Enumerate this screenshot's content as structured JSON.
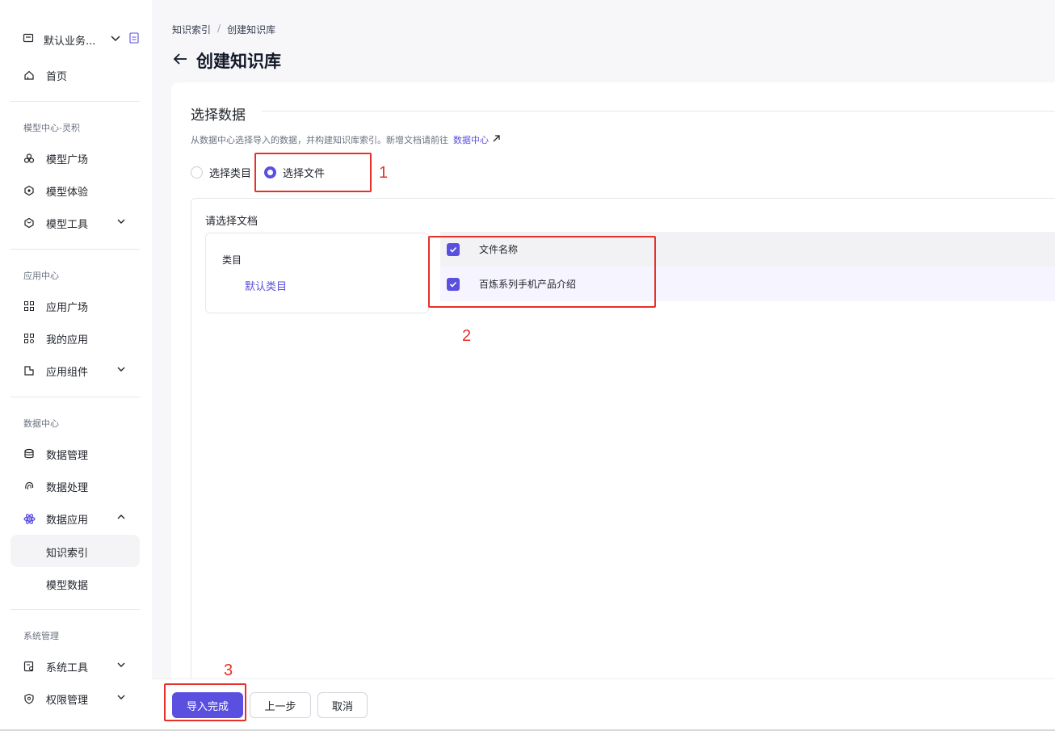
{
  "workspace": {
    "name": "默认业务..."
  },
  "nav": {
    "home": "首页",
    "groups": [
      {
        "title": "模型中心-灵积",
        "items": [
          "模型广场",
          "模型体验",
          "模型工具"
        ]
      },
      {
        "title": "应用中心",
        "items": [
          "应用广场",
          "我的应用",
          "应用组件"
        ]
      },
      {
        "title": "数据中心",
        "items": [
          "数据管理",
          "数据处理",
          "数据应用"
        ]
      },
      {
        "title": "系统管理",
        "items": [
          "系统工具",
          "权限管理"
        ]
      }
    ],
    "data_app_sub": [
      "知识索引",
      "模型数据"
    ]
  },
  "breadcrumb": [
    "知识索引",
    "创建知识库"
  ],
  "page_title": "创建知识库",
  "section": {
    "title": "选择数据",
    "hint": "从数据中心选择导入的数据，并构建知识库索引。新增文档请前往",
    "hint_link": "数据中心"
  },
  "radio": {
    "option1": "选择类目",
    "option2": "选择文件",
    "selected": "选择文件"
  },
  "picker": {
    "title": "请选择文档",
    "category_header": "类目",
    "category_item": "默认类目",
    "table_header": "文件名称",
    "rows": [
      "百炼系列手机产品介绍"
    ]
  },
  "buttons": {
    "finish": "导入完成",
    "prev": "上一步",
    "cancel": "取消"
  },
  "annotations": [
    "1",
    "2",
    "3"
  ],
  "colors": {
    "accent": "#5b4fe0",
    "annotation": "#e8302a"
  }
}
